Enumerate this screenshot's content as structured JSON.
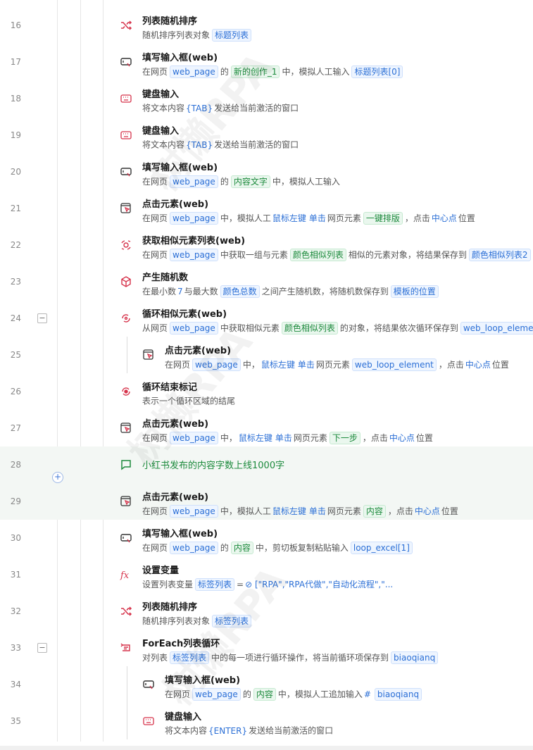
{
  "rows": [
    {
      "ln": "16",
      "icon": "shuffle-icon",
      "title": "列表随机排序",
      "desc": [
        {
          "t": "随机排序列表对象"
        },
        {
          "tag": "b",
          "t": "标题列表"
        }
      ]
    },
    {
      "ln": "17",
      "icon": "input-box-icon",
      "title": "填写输入框(web)",
      "desc": [
        {
          "t": "在网页"
        },
        {
          "tag": "b",
          "t": "web_page"
        },
        {
          "t": "的"
        },
        {
          "tag": "g",
          "t": "新的创作_1"
        },
        {
          "t": "中，模拟人工输入"
        },
        {
          "tag": "b",
          "t": "标题列表[0]"
        }
      ]
    },
    {
      "ln": "18",
      "icon": "keyboard-icon",
      "title": "键盘输入",
      "desc": [
        {
          "t": "将文本内容"
        },
        {
          "kw": true,
          "t": "{TAB}"
        },
        {
          "t": "发送给当前激活的窗口"
        }
      ]
    },
    {
      "ln": "19",
      "icon": "keyboard-icon",
      "title": "键盘输入",
      "desc": [
        {
          "t": "将文本内容"
        },
        {
          "kw": true,
          "t": "{TAB}"
        },
        {
          "t": "发送给当前激活的窗口"
        }
      ]
    },
    {
      "ln": "20",
      "icon": "input-box-icon",
      "title": "填写输入框(web)",
      "desc": [
        {
          "t": "在网页"
        },
        {
          "tag": "b",
          "t": "web_page"
        },
        {
          "t": "的"
        },
        {
          "tag": "g",
          "t": "内容文字"
        },
        {
          "t": "中，模拟人工输入"
        }
      ]
    },
    {
      "ln": "21",
      "icon": "click-element-icon",
      "title": "点击元素(web)",
      "desc": [
        {
          "t": "在网页"
        },
        {
          "tag": "b",
          "t": "web_page"
        },
        {
          "t": "中，模拟人工"
        },
        {
          "kw": true,
          "t": "鼠标左键"
        },
        {
          "kw": true,
          "t": "单击"
        },
        {
          "t": "网页元素"
        },
        {
          "tag": "g",
          "t": "一键排版"
        },
        {
          "t": "，点击"
        },
        {
          "kw": true,
          "t": "中心点"
        },
        {
          "t": "位置"
        }
      ]
    },
    {
      "ln": "22",
      "icon": "similar-elements-icon",
      "title": "获取相似元素列表(web)",
      "desc": [
        {
          "t": "在网页"
        },
        {
          "tag": "b",
          "t": "web_page"
        },
        {
          "t": "中获取一组与元素"
        },
        {
          "tag": "g",
          "t": "颜色相似列表"
        },
        {
          "t": "相似的元素对象，将结果保存到"
        },
        {
          "tag": "b",
          "t": "颜色相似列表2"
        }
      ]
    },
    {
      "ln": "23",
      "icon": "cube-icon",
      "title": "产生随机数",
      "desc": [
        {
          "t": "在最小数"
        },
        {
          "kw": true,
          "t": "7"
        },
        {
          "t": "与最大数"
        },
        {
          "tag": "b",
          "t": "颜色总数"
        },
        {
          "t": "之间产生随机数，将随机数保存到"
        },
        {
          "tag": "b",
          "t": "模板的位置"
        }
      ]
    },
    {
      "ln": "24",
      "icon": "loop-similar-icon",
      "title": "循环相似元素(web)",
      "fold": "−",
      "desc": [
        {
          "t": "从网页"
        },
        {
          "tag": "b",
          "t": "web_page"
        },
        {
          "t": "中获取相似元素"
        },
        {
          "tag": "g",
          "t": "颜色相似列表"
        },
        {
          "t": "的对象，将结果依次循环保存到"
        },
        {
          "tag": "b",
          "t": "web_loop_eleme"
        }
      ]
    },
    {
      "ln": "25",
      "icon": "click-element-icon",
      "title": "点击元素(web)",
      "nested": true,
      "desc": [
        {
          "t": "在网页"
        },
        {
          "tag": "b",
          "t": "web_page"
        },
        {
          "t": "中，"
        },
        {
          "kw": true,
          "t": "鼠标左键"
        },
        {
          "kw": true,
          "t": "单击"
        },
        {
          "t": "网页元素"
        },
        {
          "tag": "b",
          "t": "web_loop_element"
        },
        {
          "t": "，点击"
        },
        {
          "kw": true,
          "t": "中心点"
        },
        {
          "t": "位置"
        }
      ]
    },
    {
      "ln": "26",
      "icon": "loop-end-icon",
      "title": "循环结束标记",
      "desc": [
        {
          "t": "表示一个循环区域的结尾"
        }
      ]
    },
    {
      "ln": "27",
      "icon": "click-element-icon",
      "title": "点击元素(web)",
      "desc": [
        {
          "t": "在网页"
        },
        {
          "tag": "b",
          "t": "web_page"
        },
        {
          "t": "中，"
        },
        {
          "kw": true,
          "t": "鼠标左键"
        },
        {
          "kw": true,
          "t": "单击"
        },
        {
          "t": "网页元素"
        },
        {
          "tag": "g",
          "t": "下一步"
        },
        {
          "t": "，点击"
        },
        {
          "kw": true,
          "t": "中心点"
        },
        {
          "t": "位置"
        }
      ]
    },
    {
      "ln": "28",
      "icon": "comment-icon",
      "comment": "小红书发布的内容字数上线1000字",
      "highlight": true
    },
    {
      "ln": "29",
      "icon": "click-element-icon",
      "title": "点击元素(web)",
      "highlight": true,
      "desc": [
        {
          "t": "在网页"
        },
        {
          "tag": "b",
          "t": "web_page"
        },
        {
          "t": "中，模拟人工"
        },
        {
          "kw": true,
          "t": "鼠标左键"
        },
        {
          "kw": true,
          "t": "单击"
        },
        {
          "t": "网页元素"
        },
        {
          "tag": "g",
          "t": "内容"
        },
        {
          "t": "，点击"
        },
        {
          "kw": true,
          "t": "中心点"
        },
        {
          "t": "位置"
        }
      ]
    },
    {
      "ln": "30",
      "icon": "input-box-icon",
      "title": "填写输入框(web)",
      "desc": [
        {
          "t": "在网页"
        },
        {
          "tag": "b",
          "t": "web_page"
        },
        {
          "t": "的"
        },
        {
          "tag": "g",
          "t": "内容"
        },
        {
          "t": "中，剪切板复制粘贴输入"
        },
        {
          "tag": "b",
          "t": "loop_excel[1]"
        }
      ]
    },
    {
      "ln": "31",
      "icon": "function-icon",
      "title": "设置变量",
      "desc": [
        {
          "t": "设置列表变量"
        },
        {
          "tag": "b",
          "t": "标签列表"
        },
        {
          "t": "="
        },
        {
          "kw": true,
          "t": "⊘ [\"RPA\",\"RPA代做\",\"自动化流程\",\"..."
        }
      ]
    },
    {
      "ln": "32",
      "icon": "shuffle-icon",
      "title": "列表随机排序",
      "desc": [
        {
          "t": "随机排序列表对象"
        },
        {
          "tag": "b",
          "t": "标签列表"
        }
      ]
    },
    {
      "ln": "33",
      "icon": "foreach-icon",
      "title": "ForEach列表循环",
      "fold": "−",
      "desc": [
        {
          "t": "对列表"
        },
        {
          "tag": "b",
          "t": "标签列表"
        },
        {
          "t": "中的每一项进行循环操作，将当前循环项保存到"
        },
        {
          "tag": "b",
          "t": "biaoqianq"
        }
      ]
    },
    {
      "ln": "34",
      "icon": "input-box-icon",
      "title": "填写输入框(web)",
      "nested": true,
      "desc": [
        {
          "t": "在网页"
        },
        {
          "tag": "b",
          "t": "web_page"
        },
        {
          "t": "的"
        },
        {
          "tag": "g",
          "t": "内容"
        },
        {
          "t": "中，模拟人工追加输入"
        },
        {
          "kw": true,
          "t": "#"
        },
        {
          "tag": "b",
          "t": "biaoqianq"
        }
      ]
    },
    {
      "ln": "35",
      "icon": "keyboard-icon",
      "title": "键盘输入",
      "nested": true,
      "desc": [
        {
          "t": "将文本内容"
        },
        {
          "kw": true,
          "t": "{ENTER}"
        },
        {
          "t": "发送给当前激活的窗口"
        }
      ]
    }
  ],
  "watermark": "树懒RPA"
}
